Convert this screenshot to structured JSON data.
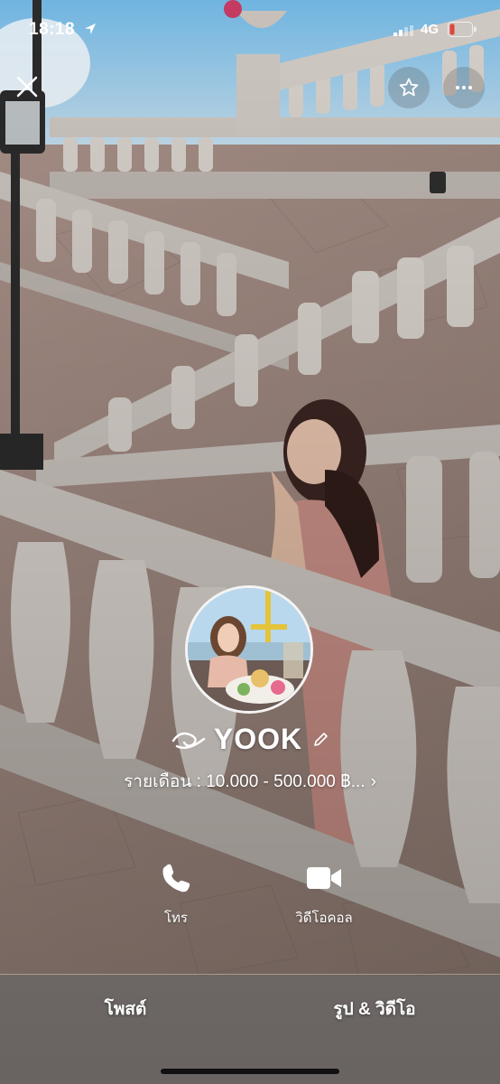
{
  "status_bar": {
    "time": "18:18",
    "location_icon": "location-arrow-icon",
    "network": "4G",
    "battery_color": "#e0463a"
  },
  "top_controls": {
    "close_icon": "close-icon",
    "favorite_icon": "star-icon",
    "more_icon": "more-icon"
  },
  "profile": {
    "name": "YOOK",
    "income_text": "รายเดือน : 10.000 - 500.000 ฿...",
    "income_chevron": "›",
    "edit_icon": "pencil-icon"
  },
  "actions": [
    {
      "label": "โทร",
      "icon": "phone-icon"
    },
    {
      "label": "วิดีโอคอล",
      "icon": "video-camera-icon"
    }
  ],
  "tabs": [
    {
      "label": "โพสต์"
    },
    {
      "label": "รูป & วิดีโอ"
    }
  ]
}
